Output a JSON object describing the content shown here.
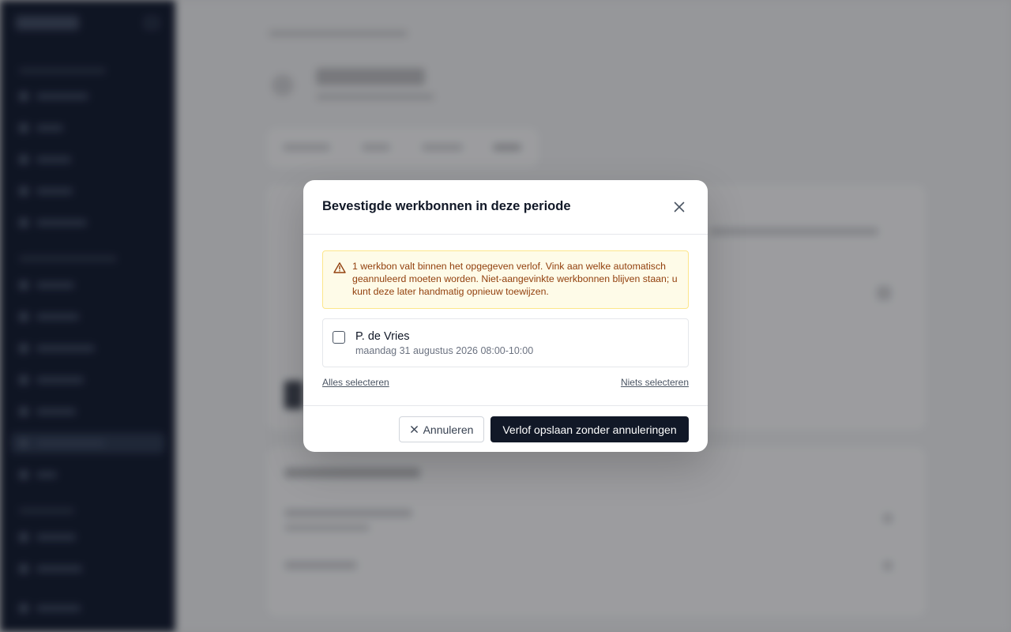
{
  "modal": {
    "title": "Bevestigde werkbonnen in deze periode",
    "close_icon": "close-icon",
    "warning": {
      "icon": "warning-triangle-icon",
      "text": "1 werkbon valt binnen het opgegeven verlof. Vink aan welke automatisch geannuleerd moeten worden. Niet-aangevinkte werkbonnen blijven staan; u kunt deze later handmatig opnieuw toewijzen."
    },
    "items": [
      {
        "name": "P. de Vries",
        "datetime": "maandag 31 augustus 2026 08:00-10:00",
        "checked": false
      }
    ],
    "select_all": "Alles selecteren",
    "select_none": "Niets selecteren",
    "cancel_label": "Annuleren",
    "confirm_label": "Verlof opslaan zonder annuleringen"
  },
  "colors": {
    "primary": "#111827",
    "warning_bg": "#fefbe8",
    "warning_border": "#fde68a",
    "warning_text": "#92400e",
    "sidebar_bg": "#0b1120"
  }
}
